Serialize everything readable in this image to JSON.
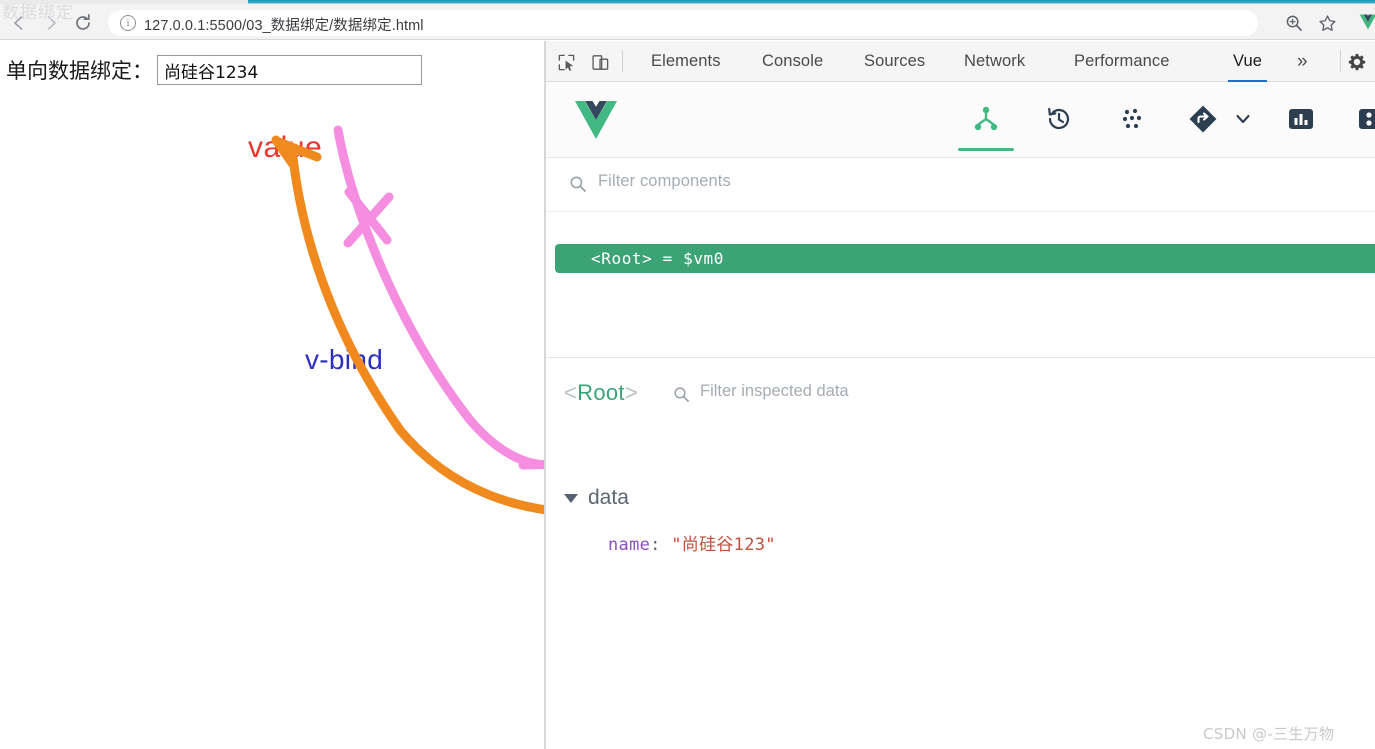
{
  "browser": {
    "url": "127.0.0.1:5500/03_数据绑定/数据绑定.html",
    "back_icon": "back-arrow-icon",
    "forward_icon": "forward-arrow-icon",
    "reload_icon": "reload-icon",
    "info_icon": "page-info-icon",
    "zoom_icon": "zoom-icon",
    "bookmark_icon": "star-icon",
    "extension_icon": "vue-devtools-extension-icon",
    "watermark": "数据绑定"
  },
  "page": {
    "label": "单向数据绑定：",
    "input_value": "尚硅谷1234",
    "input_placeholder": "",
    "annotations": {
      "value": "value",
      "vbind": "v-bind"
    },
    "colors": {
      "value_text": "#e8342b",
      "vbind_text": "#2d2fbe",
      "orange_arrow": "#f08a1e",
      "pink_arrow": "#f58ee0"
    }
  },
  "devtools": {
    "tools": {
      "inspect_icon": "inspect-element-icon",
      "device_icon": "device-toolbar-icon",
      "settings_icon": "gear-icon"
    },
    "tabs": [
      {
        "label": "Elements",
        "active": false
      },
      {
        "label": "Console",
        "active": false
      },
      {
        "label": "Sources",
        "active": false
      },
      {
        "label": "Network",
        "active": false
      },
      {
        "label": "Performance",
        "active": false
      },
      {
        "label": "Vue",
        "active": true
      }
    ],
    "more_tabs": "»",
    "active_tab_color": "#1a73c9"
  },
  "vue_panel": {
    "logo": "vue-logo-icon",
    "header_icons": [
      {
        "name": "component-tree-icon",
        "active": true
      },
      {
        "name": "timeline-history-icon",
        "active": false
      },
      {
        "name": "vuex-icon",
        "active": false
      },
      {
        "name": "router-icon",
        "active": false
      },
      {
        "name": "chevron-down-icon",
        "active": false
      },
      {
        "name": "performance-chart-icon",
        "active": false
      },
      {
        "name": "settings-puzzle-icon",
        "active": false
      }
    ],
    "filter_components_placeholder": "Filter components",
    "filter_components_icon": "search-icon",
    "tree": {
      "selected_row": "<Root> = $vm0",
      "selected_color": "#3ca375"
    },
    "inspector": {
      "component_open_bracket": "<",
      "component_name": "Root",
      "component_close_bracket": ">",
      "filter_placeholder": "Filter inspected data",
      "filter_icon": "search-icon",
      "data_section_label": "data",
      "data_expanded": true,
      "properties": [
        {
          "key": "name",
          "separator": ":",
          "value": "\"尚硅谷123\""
        }
      ]
    }
  },
  "footer": {
    "watermark": "CSDN @-三生万物"
  }
}
